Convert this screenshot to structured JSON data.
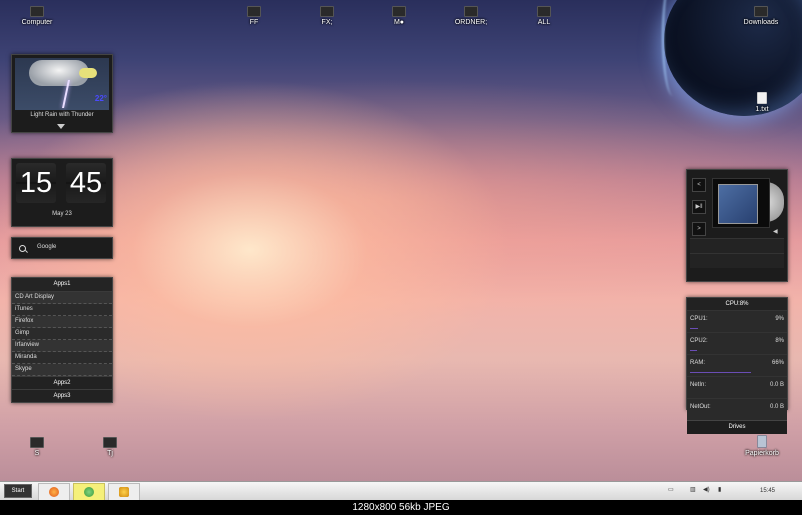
{
  "desktop": {
    "top_icons": [
      {
        "label": "Computer"
      },
      {
        "label": "FF"
      },
      {
        "label": "FX;"
      },
      {
        "label": "M●"
      },
      {
        "label": "ORDNER;"
      },
      {
        "label": "ALL"
      },
      {
        "label": "Downloads"
      }
    ],
    "file_icon": {
      "label": "1.txt"
    },
    "bottom_icons": [
      {
        "label": "S"
      },
      {
        "label": "Tj"
      }
    ],
    "trash": {
      "label": "Papierkorb"
    }
  },
  "weather": {
    "condition": "Light Rain with Thunder",
    "temperature": "22°"
  },
  "clock_widget": {
    "hour": "15",
    "minute": "45",
    "date": "May  23"
  },
  "search": {
    "placeholder": "Google"
  },
  "apps": {
    "header": "Apps1",
    "items": [
      "CD Art Display",
      "iTunes",
      "Firefox",
      "Gimp",
      "Irfanview",
      "Miranda",
      "Skype"
    ],
    "groups": [
      "Apps2",
      "Apps3"
    ]
  },
  "media_player": {
    "buttons": [
      {
        "symbol": "<"
      },
      {
        "symbol": "▶‖"
      },
      {
        "symbol": ">"
      }
    ],
    "volume_symbol": "◀"
  },
  "system_monitor": {
    "header": "CPU:8%",
    "rows": [
      {
        "label": "CPU1:",
        "value": "9%",
        "fill": 0.09
      },
      {
        "label": "CPU2:",
        "value": "8%",
        "fill": 0.08
      },
      {
        "label": "RAM:",
        "value": "66%",
        "fill": 0.66
      },
      {
        "label": "NetIn:",
        "value": "0.0 B",
        "fill": 0
      },
      {
        "label": "NetOut:",
        "value": "0.0 B",
        "fill": 0
      }
    ],
    "footer": "Drives"
  },
  "taskbar": {
    "start_label": "Start",
    "time": "15:45"
  },
  "caption": "1280x800  56kb  JPEG",
  "colors": {
    "accent_bar": "#6a4db5",
    "panel_bg": "#1c1c1c"
  }
}
